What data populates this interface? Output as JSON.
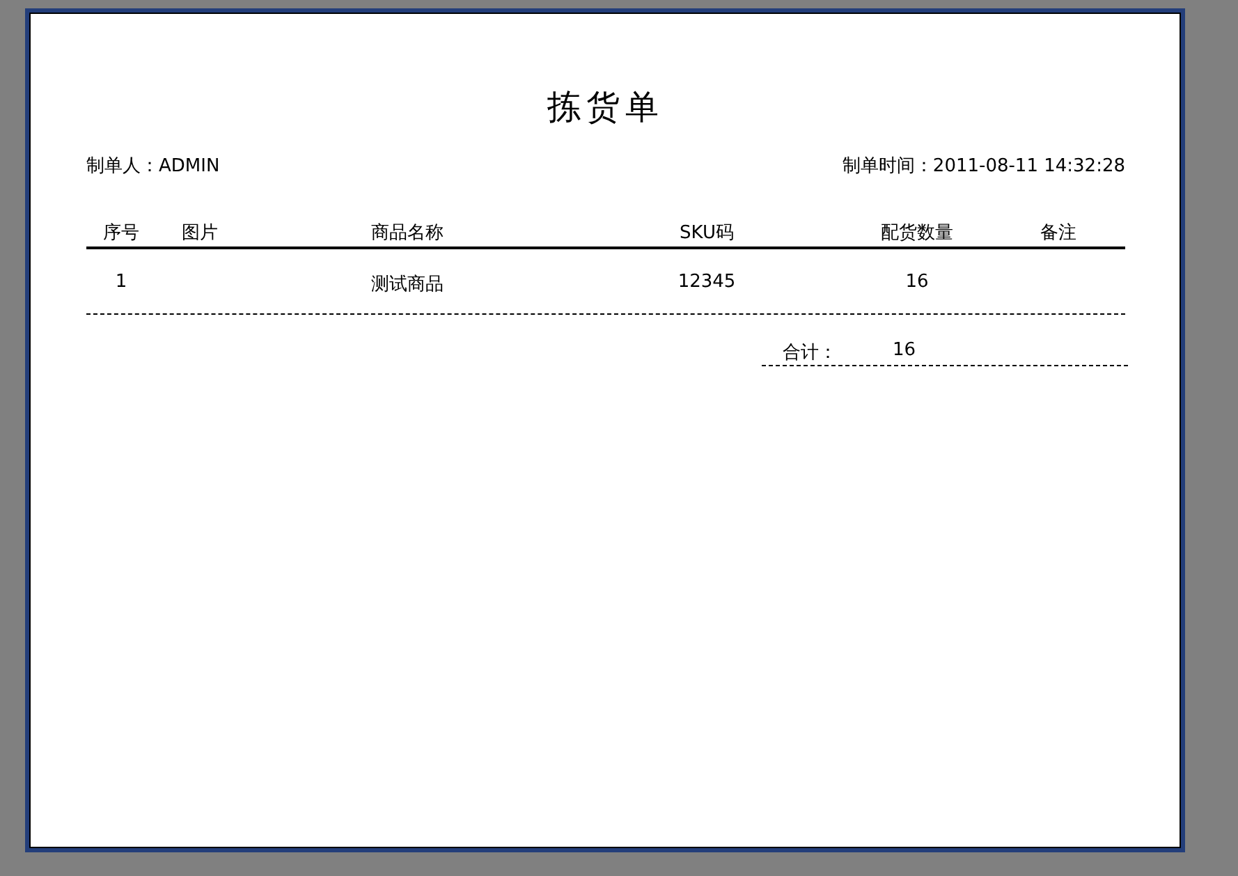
{
  "title": "拣货单",
  "creator": "制单人：ADMIN",
  "created_time": "制单时间：2011-08-11 14:32:28",
  "table": {
    "columns": [
      "序号",
      "图片",
      "商品名称",
      "SKU码",
      "配货数量",
      "备注"
    ],
    "rows": [
      [
        "1",
        "",
        "测试商品",
        "12345",
        "16",
        ""
      ]
    ]
  },
  "total": {
    "label": "合计：",
    "value": "16"
  }
}
